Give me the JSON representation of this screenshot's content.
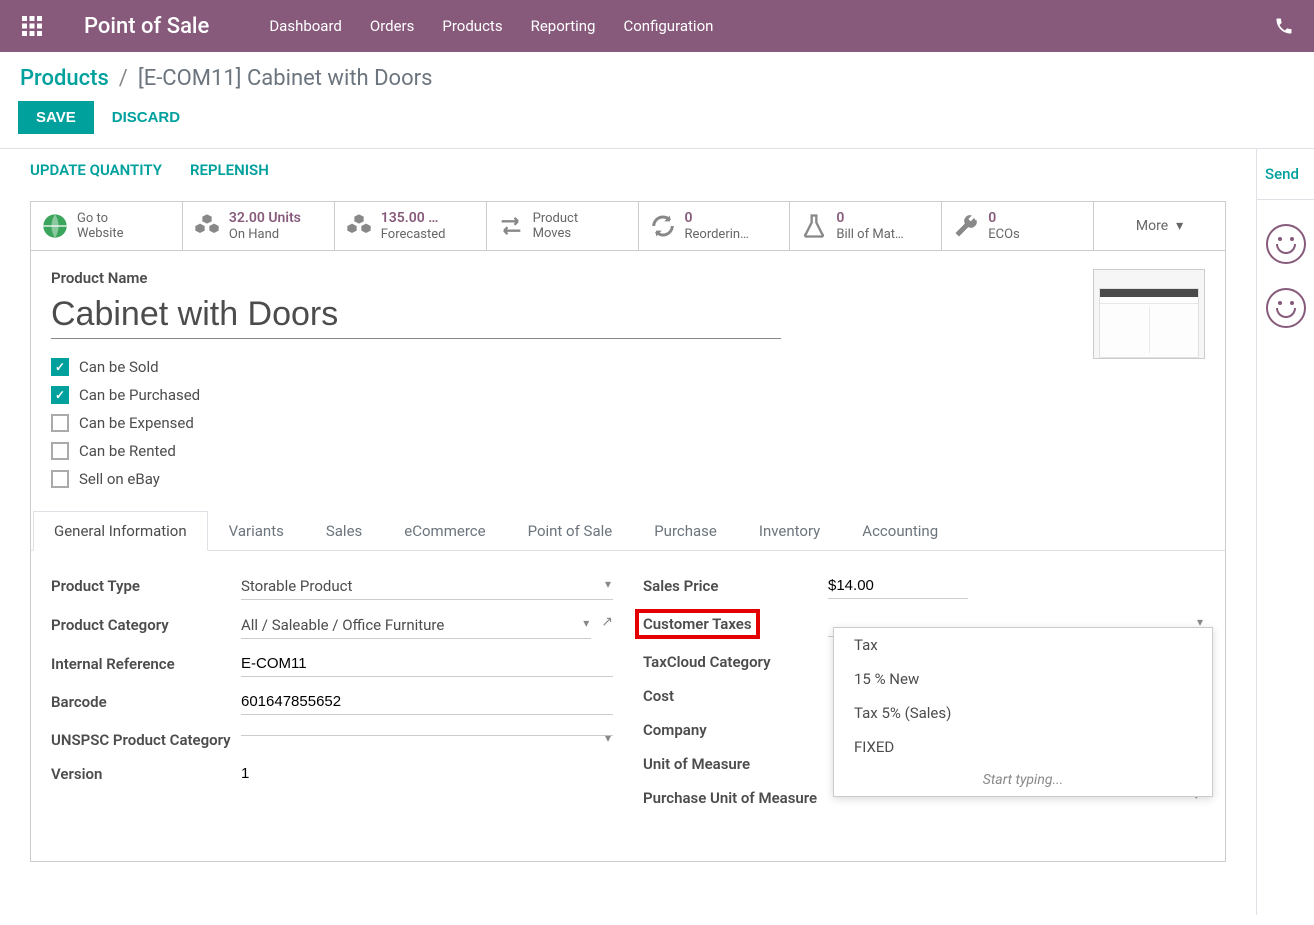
{
  "app": {
    "title": "Point of Sale"
  },
  "nav": {
    "items": [
      "Dashboard",
      "Orders",
      "Products",
      "Reporting",
      "Configuration"
    ]
  },
  "breadcrumb": {
    "parent": "Products",
    "current": "[E-COM11] Cabinet with Doors"
  },
  "buttons": {
    "save": "SAVE",
    "discard": "DISCARD"
  },
  "subactions": {
    "update_qty": "UPDATE QUANTITY",
    "replenish": "REPLENISH"
  },
  "side": {
    "send": "Send"
  },
  "stats": {
    "website": {
      "label1": "Go to",
      "label2": "Website"
    },
    "onhand": {
      "value": "32.00 Units",
      "label": "On Hand"
    },
    "forecast": {
      "value": "135.00 …",
      "label": "Forecasted"
    },
    "moves": {
      "label1": "Product",
      "label2": "Moves"
    },
    "reorder": {
      "value": "0",
      "label": "Reorderin…"
    },
    "bom": {
      "value": "0",
      "label": "Bill of Mat…"
    },
    "ecos": {
      "value": "0",
      "label": "ECOs"
    },
    "more": {
      "label": "More"
    }
  },
  "product": {
    "name_label": "Product Name",
    "name": "Cabinet with Doors",
    "checks": {
      "sold": {
        "label": "Can be Sold",
        "checked": true
      },
      "purchased": {
        "label": "Can be Purchased",
        "checked": true
      },
      "expensed": {
        "label": "Can be Expensed",
        "checked": false
      },
      "rented": {
        "label": "Can be Rented",
        "checked": false
      },
      "ebay": {
        "label": "Sell on eBay",
        "checked": false
      }
    }
  },
  "tabs": [
    "General Information",
    "Variants",
    "Sales",
    "eCommerce",
    "Point of Sale",
    "Purchase",
    "Inventory",
    "Accounting"
  ],
  "fields": {
    "product_type": {
      "label": "Product Type",
      "value": "Storable Product"
    },
    "product_category": {
      "label": "Product Category",
      "value": "All / Saleable / Office Furniture"
    },
    "internal_ref": {
      "label": "Internal Reference",
      "value": "E-COM11"
    },
    "barcode": {
      "label": "Barcode",
      "value": "601647855652"
    },
    "unspsc": {
      "label": "UNSPSC Product Category",
      "value": ""
    },
    "version": {
      "label": "Version",
      "value": "1"
    },
    "sales_price": {
      "label": "Sales Price",
      "value": "$14.00"
    },
    "customer_taxes": {
      "label": "Customer Taxes",
      "value": ""
    },
    "taxcloud": {
      "label": "TaxCloud Category",
      "value": ""
    },
    "cost": {
      "label": "Cost",
      "value": ""
    },
    "company": {
      "label": "Company",
      "value": ""
    },
    "uom": {
      "label": "Unit of Measure",
      "value": ""
    },
    "purchase_uom": {
      "label": "Purchase Unit of Measure",
      "value": ""
    }
  },
  "tax_dropdown": {
    "options": [
      "Tax",
      "15 % New",
      "Tax 5% (Sales)",
      "FIXED"
    ],
    "search_placeholder": "Start typing..."
  }
}
